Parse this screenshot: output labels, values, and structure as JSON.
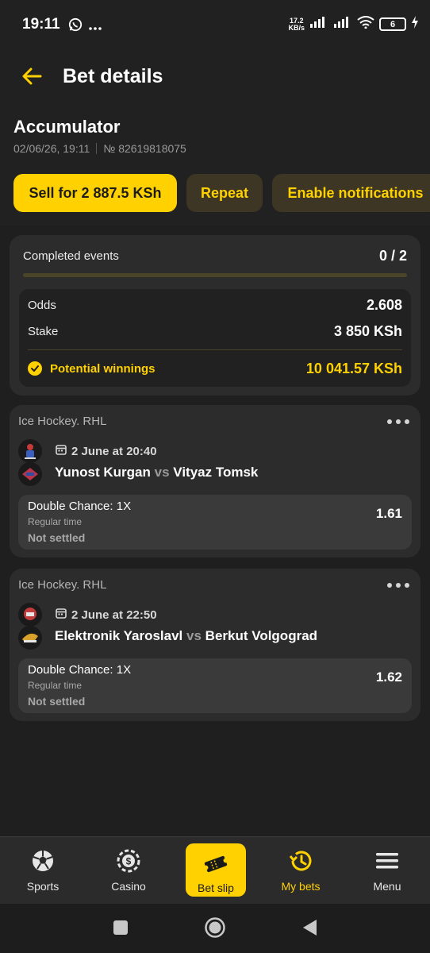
{
  "status_bar": {
    "time": "19:11",
    "net_speed_value": "17.2",
    "net_speed_unit": "KB/s",
    "battery": "6"
  },
  "header": {
    "title": "Bet details"
  },
  "bet": {
    "type": "Accumulator",
    "datetime": "02/06/26, 19:11",
    "number": "№ 82619818075",
    "sell_label": "Sell for 2 887.5 KSh",
    "repeat_label": "Repeat",
    "notifications_label": "Enable notifications"
  },
  "summary": {
    "completed_label": "Completed events",
    "completed_value": "0 / 2",
    "completed_fraction": 0,
    "odds_label": "Odds",
    "odds_value": "2.608",
    "stake_label": "Stake",
    "stake_value": "3 850 KSh",
    "winnings_label": "Potential winnings",
    "winnings_value": "10 041.57 KSh"
  },
  "events": [
    {
      "league": "Ice Hockey. RHL",
      "date": "2 June at 20:40",
      "home": "Yunost Kurgan",
      "vs": "vs",
      "away": "Vityaz Tomsk",
      "market": "Double Chance: 1X",
      "period": "Regular time",
      "status": "Not settled",
      "odds": "1.61"
    },
    {
      "league": "Ice Hockey. RHL",
      "date": "2 June at 22:50",
      "home": "Elektronik Yaroslavl",
      "vs": "vs",
      "away": "Berkut Volgograd",
      "market": "Double Chance: 1X",
      "period": "Regular time",
      "status": "Not settled",
      "odds": "1.62"
    }
  ],
  "bottom_nav": {
    "items": [
      {
        "label": "Sports",
        "icon": "soccer-ball-icon"
      },
      {
        "label": "Casino",
        "icon": "casino-chip-icon"
      },
      {
        "label": "Bet slip",
        "icon": "ticket-icon"
      },
      {
        "label": "My bets",
        "icon": "history-icon"
      },
      {
        "label": "Menu",
        "icon": "menu-icon"
      }
    ]
  },
  "colors": {
    "accent": "#ffd100",
    "background": "#1f1f1f",
    "card": "#2c2c2c"
  }
}
